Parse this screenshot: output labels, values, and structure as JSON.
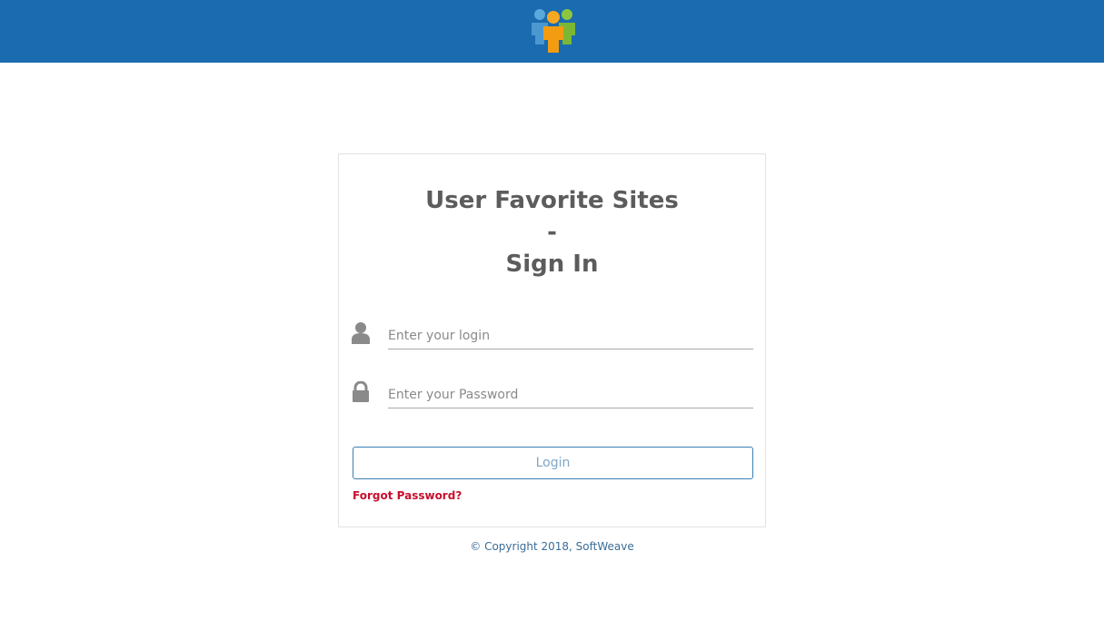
{
  "header": {
    "background_color": "#1a6bb0",
    "logo_icon": "users-group-icon"
  },
  "signin": {
    "title_line1": "User Favorite Sites",
    "title_line2": "-",
    "title_line3": "Sign In",
    "login_field": {
      "icon": "user-icon",
      "placeholder": "Enter your login",
      "value": ""
    },
    "password_field": {
      "icon": "lock-icon",
      "placeholder": "Enter your Password",
      "value": ""
    },
    "login_button_label": "Login",
    "forgot_password_label": "Forgot Password?",
    "accent_color": "#3c7fb4",
    "link_color": "#c8102e"
  },
  "footer": {
    "copyright": "© Copyright 2018, SoftWeave"
  }
}
